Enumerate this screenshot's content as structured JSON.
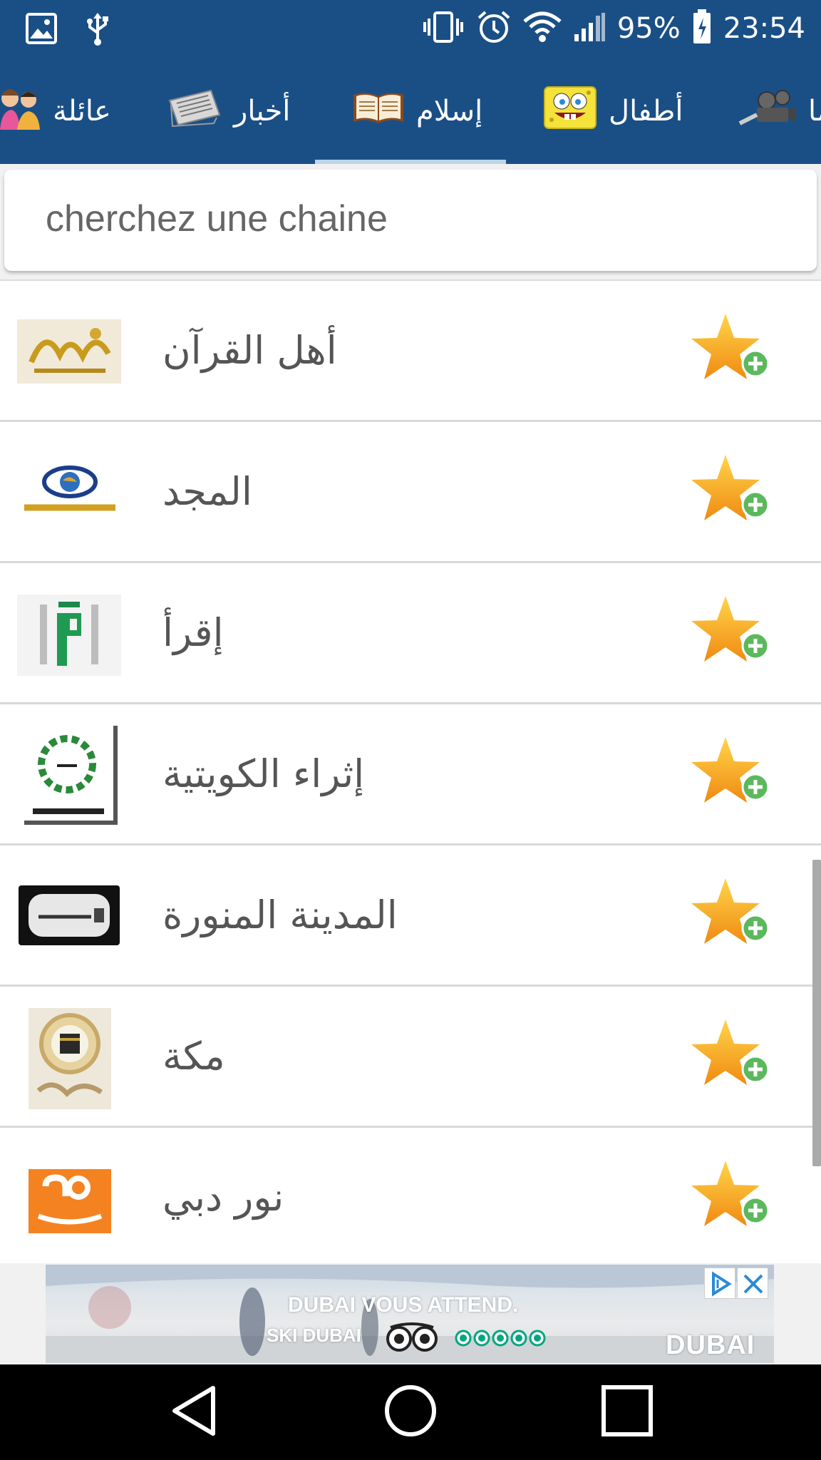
{
  "status_bar": {
    "battery_percent": "95%",
    "time": "23:54",
    "icons": [
      "gallery-icon",
      "usb-icon",
      "vibrate-icon",
      "alarm-icon",
      "wifi-icon",
      "signal-icon",
      "battery-icon"
    ]
  },
  "tabs": [
    {
      "label": "عائلة",
      "icon": "family-icon"
    },
    {
      "label": "أخبار",
      "icon": "newspaper-icon"
    },
    {
      "label": "إسلام",
      "icon": "quran-book-icon",
      "selected": true
    },
    {
      "label": "أطفال",
      "icon": "spongebob-icon"
    },
    {
      "label": "ما",
      "icon": "film-camera-icon"
    }
  ],
  "search": {
    "placeholder": "cherchez une chaine",
    "value": ""
  },
  "channels": [
    {
      "name": "أهل القرآن",
      "logo": "ahl-alquran-logo"
    },
    {
      "name": "المجد",
      "logo": "almajd-logo"
    },
    {
      "name": "إقرأ",
      "logo": "iqraa-logo"
    },
    {
      "name": "إثراء الكويتية",
      "logo": "ithraa-kuwait-logo"
    },
    {
      "name": "المدينة المنورة",
      "logo": "sunnah-logo"
    },
    {
      "name": "مكة",
      "logo": "makkah-logo"
    },
    {
      "name": "نور دبي",
      "logo": "noor-dubai-logo"
    }
  ],
  "ad": {
    "headline": "DUBAI VOUS ATTEND.",
    "subline": "SKI DUBAI",
    "brand": "DUBAI"
  },
  "colors": {
    "primary": "#1a4f86",
    "tab_indicator": "#bcd6e8",
    "star": "#f7a81b",
    "plus": "#5cb85c"
  }
}
